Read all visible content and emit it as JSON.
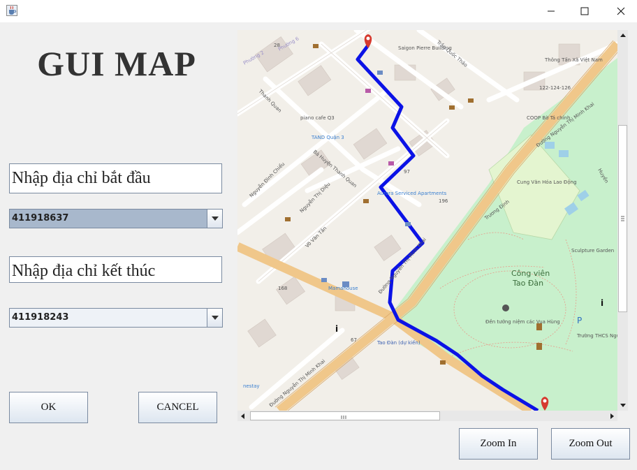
{
  "window": {
    "app_icon": "java-cup-icon",
    "controls": [
      "minimize-icon",
      "maximize-icon",
      "close-icon"
    ]
  },
  "heading": "GUI MAP",
  "start": {
    "label": "Nhập địa chỉ bắt đầu",
    "selected": "411918637"
  },
  "end": {
    "label": "Nhập địa chỉ kết thúc",
    "selected": "411918243"
  },
  "buttons": {
    "ok": "OK",
    "cancel": "CANCEL",
    "zoom_in": "Zoom In",
    "zoom_out": "Zoom Out"
  },
  "map": {
    "route_color": "#0b12e6",
    "park_color": "#c8f0cc",
    "marker_color": "#d63a2f",
    "labels": {
      "saigon_pierre": "Saigon Pierre Building",
      "le_quy_don": "Trần Quốc Thảo",
      "thong_tan_xa": "Thông Tấn Xã Việt Nam",
      "thong_tan_addr": "122-124-126",
      "coop": "COOP Bờ Tá chính",
      "nguyen_thi_minh_khai_1": "Đường Nguyễn Thị Minh Khai",
      "nguyen_thi_minh_khai_2": "Đường Nguyễn Thị Minh Khai",
      "truong_dinh": "Trương Định",
      "cong_vien": "Công viên",
      "tao_dan": "Tao Đàn",
      "cung_van_hoa": "Cung Văn Hóa Lao Động",
      "sculpture": "Sculpture Garden",
      "den_tuong_niem": "Đền tưởng niệm các Vua Hùng",
      "tao_dan_du_kien": "Tao Đàn (dự kiến)",
      "aurora": "Aurora Serviced Apartments",
      "mamahouse": "Mamahouse",
      "piano_cafe": "piano cafe Q3",
      "tand": "TAND Quận 3",
      "ba_huyen": "Bà Huyện Thanh Quan",
      "nguyen_dinh_chieu": "Nguyễn Đình Chiểu",
      "nguyen_thi_dieu": "Nguyễn Thị Diệu",
      "vo_van_tan": "Võ Văn Tần",
      "thanh_quan": "Thanh Quan",
      "ward": "Phường 6",
      "truong_thcs": "Trường THCS Nguyễn Du",
      "huyen": "Huyền",
      "phuong2": "Phường 2",
      "nestay": "nestay",
      "num_67": "67",
      "num_196": "196",
      "num_97": "97",
      "num_28": "28",
      "num_168": "168"
    }
  }
}
